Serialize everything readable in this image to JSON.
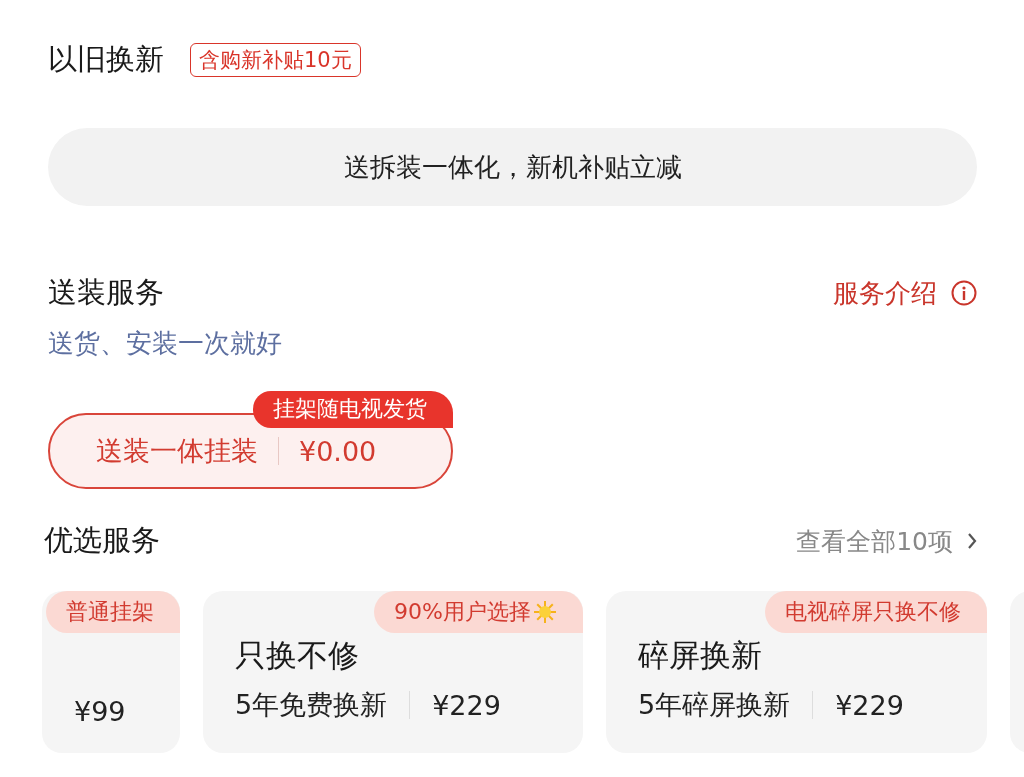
{
  "trade_in": {
    "title": "以旧换新",
    "badge": "含购新补贴10元",
    "banner": "送拆装一体化，新机补贴立减"
  },
  "delivery": {
    "title": "送装服务",
    "link": "服务介绍",
    "subtitle": "送货、安装一次就好",
    "options": [
      {
        "label": "送装一体挂装",
        "price": "¥0.00",
        "tag": "挂架随电视发货",
        "selected": true
      }
    ]
  },
  "preferred": {
    "title": "优选服务",
    "more": "查看全部10项",
    "cards": [
      {
        "tag": "普通挂架",
        "price": "¥99",
        "selected": false
      },
      {
        "tag": "90%用户选择",
        "tag_has_icon": true,
        "title": "只换不修",
        "detail": "5年免费换新",
        "price": "¥229",
        "selected": false
      },
      {
        "tag": "电视碎屏只换不修",
        "title": "碎屏换新",
        "detail": "5年碎屏换新",
        "price": "¥229",
        "selected": false
      },
      {
        "selected": false
      }
    ]
  }
}
